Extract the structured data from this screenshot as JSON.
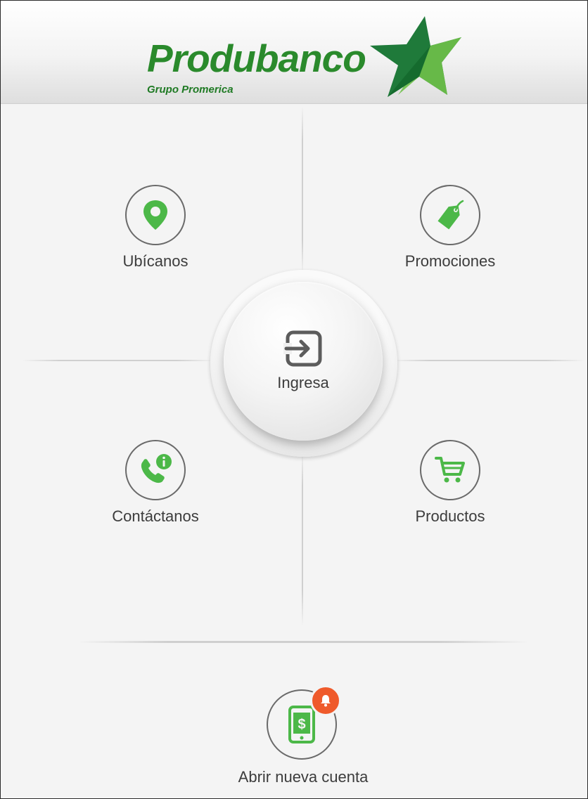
{
  "header": {
    "brand": "Produbanco",
    "subtitle": "Grupo Promerica"
  },
  "menu": {
    "ubicanos": {
      "label": "Ubícanos",
      "icon": "map-pin-icon"
    },
    "promociones": {
      "label": "Promociones",
      "icon": "price-tag-icon"
    },
    "ingresa": {
      "label": "Ingresa",
      "icon": "login-icon"
    },
    "contactanos": {
      "label": "Contáctanos",
      "icon": "phone-info-icon"
    },
    "productos": {
      "label": "Productos",
      "icon": "shopping-cart-icon"
    }
  },
  "footer": {
    "open_account": {
      "label": "Abrir nueva cuenta",
      "icon": "mobile-money-icon",
      "badge_icon": "bell-icon"
    }
  },
  "colors": {
    "brand_green": "#2a8a2c",
    "icon_green": "#4cb848",
    "badge_orange": "#ef5a2b",
    "icon_gray": "#5c5c5c"
  }
}
